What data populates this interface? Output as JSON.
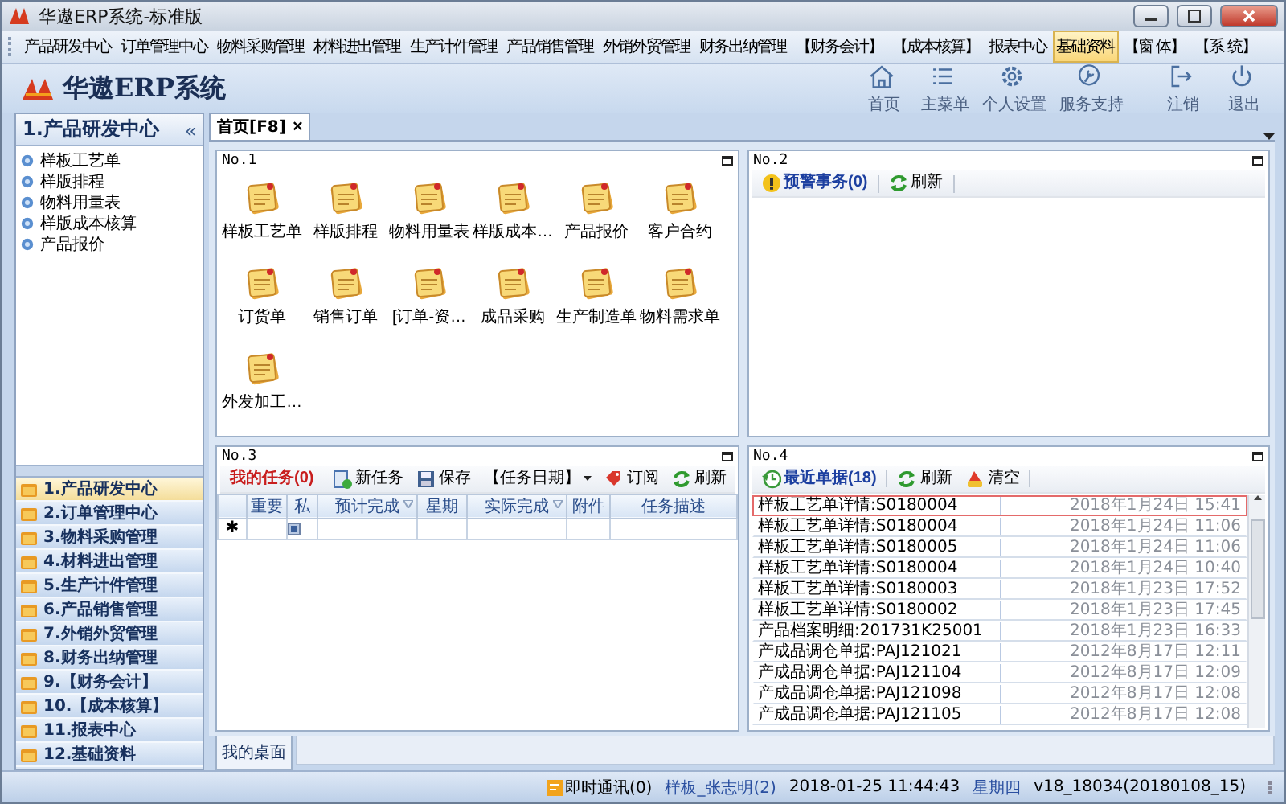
{
  "window": {
    "title": "华遨ERP系统-标准版"
  },
  "menu": [
    {
      "label": "产品研发中心",
      "selected": false
    },
    {
      "label": "订单管理中心",
      "selected": false
    },
    {
      "label": "物料采购管理",
      "selected": false
    },
    {
      "label": "材料进出管理",
      "selected": false
    },
    {
      "label": "生产计件管理",
      "selected": false
    },
    {
      "label": "产品销售管理",
      "selected": false
    },
    {
      "label": "外销外贸管理",
      "selected": false
    },
    {
      "label": "财务出纳管理",
      "selected": false
    },
    {
      "label": "【财务会计】",
      "selected": false
    },
    {
      "label": "【成本核算】",
      "selected": false
    },
    {
      "label": "报表中心",
      "selected": false
    },
    {
      "label": "基础资料",
      "selected": true
    },
    {
      "label": "【窗 体】",
      "selected": false
    },
    {
      "label": "【系 统】",
      "selected": false
    }
  ],
  "header": {
    "logo_text": "华遨ERP系统",
    "tools": [
      {
        "kind": "home",
        "label": "首页"
      },
      {
        "kind": "menu",
        "label": "主菜单"
      },
      {
        "kind": "settings",
        "label": "个人设置"
      },
      {
        "kind": "support",
        "label": "服务支持"
      },
      {
        "kind": "logout",
        "label": "注销"
      },
      {
        "kind": "exit",
        "label": "退出"
      }
    ]
  },
  "sidebar": {
    "title": "1.产品研发中心",
    "collapse": "«",
    "items": [
      "样板工艺单",
      "样版排程",
      "物料用量表",
      "样版成本核算",
      "产品报价"
    ],
    "groups": [
      {
        "label": "1.产品研发中心",
        "selected": true
      },
      {
        "label": "2.订单管理中心",
        "selected": false
      },
      {
        "label": "3.物料采购管理",
        "selected": false
      },
      {
        "label": "4.材料进出管理",
        "selected": false
      },
      {
        "label": "5.生产计件管理",
        "selected": false
      },
      {
        "label": "6.产品销售管理",
        "selected": false
      },
      {
        "label": "7.外销外贸管理",
        "selected": false
      },
      {
        "label": "8.财务出纳管理",
        "selected": false
      },
      {
        "label": "9.【财务会计】",
        "selected": false
      },
      {
        "label": "10.【成本核算】",
        "selected": false
      },
      {
        "label": "11.报表中心",
        "selected": false
      },
      {
        "label": "12.基础资料",
        "selected": false
      }
    ]
  },
  "tabs": [
    {
      "label": "首页[F8]",
      "close": "×",
      "selected": true
    }
  ],
  "panel_1": {
    "title": "No.1",
    "shortcuts": [
      "样板工艺单",
      "样版排程",
      "物料用量表",
      "样版成本…",
      "产品报价",
      "客户合约",
      "订货单",
      "销售订单",
      "[订单-资…",
      "成品采购",
      "生产制造单",
      "物料需求单",
      "外发加工…"
    ]
  },
  "panel_2": {
    "title": "No.2",
    "toolbar": [
      {
        "kind": "warning",
        "label": "预警事务(0)"
      },
      {
        "kind": "refresh",
        "label": "刷新"
      }
    ]
  },
  "panel_3": {
    "title": "No.3",
    "toolbar": [
      {
        "kind": "tasks",
        "label": "我的任务(0)"
      },
      {
        "kind": "new",
        "label": "新任务"
      },
      {
        "kind": "save",
        "label": "保存"
      },
      {
        "kind": "dropdown",
        "label": "【任务日期】"
      },
      {
        "kind": "subscribe",
        "label": "订阅"
      },
      {
        "kind": "refresh",
        "label": "刷新"
      }
    ],
    "columns": [
      {
        "label": "重要",
        "filter": false
      },
      {
        "label": "私",
        "filter": false
      },
      {
        "label": "预计完成",
        "filter": true
      },
      {
        "label": "星期",
        "filter": false
      },
      {
        "label": "实际完成",
        "filter": true
      },
      {
        "label": "附件",
        "filter": false
      },
      {
        "label": "任务描述",
        "filter": false
      }
    ],
    "new_row_marker": "✱"
  },
  "panel_4": {
    "title": "No.4",
    "toolbar": [
      {
        "kind": "recent",
        "label": "最近单据(18)"
      },
      {
        "kind": "refresh",
        "label": "刷新"
      },
      {
        "kind": "clear",
        "label": "清空"
      }
    ],
    "rows": [
      {
        "name": "样板工艺单详情:S0180004",
        "date": "2018年1月24日",
        "time": "15:41",
        "selected": true
      },
      {
        "name": "样板工艺单详情:S0180004",
        "date": "2018年1月24日",
        "time": "11:06",
        "selected": false
      },
      {
        "name": "样板工艺单详情:S0180005",
        "date": "2018年1月24日",
        "time": "11:06",
        "selected": false
      },
      {
        "name": "样板工艺单详情:S0180004",
        "date": "2018年1月24日",
        "time": "10:40",
        "selected": false
      },
      {
        "name": "样板工艺单详情:S0180003",
        "date": "2018年1月23日",
        "time": "17:52",
        "selected": false
      },
      {
        "name": "样板工艺单详情:S0180002",
        "date": "2018年1月23日",
        "time": "17:45",
        "selected": false
      },
      {
        "name": "产品档案明细:201731K25001",
        "date": "2018年1月23日",
        "time": "16:33",
        "selected": false
      },
      {
        "name": "产成品调仓单据:PAJ121021",
        "date": "2012年8月17日",
        "time": "12:11",
        "selected": false
      },
      {
        "name": "产成品调仓单据:PAJ121104",
        "date": "2012年8月17日",
        "time": "12:09",
        "selected": false
      },
      {
        "name": "产成品调仓单据:PAJ121098",
        "date": "2012年8月17日",
        "time": "12:08",
        "selected": false
      },
      {
        "name": "产成品调仓单据:PAJ121105",
        "date": "2012年8月17日",
        "time": "12:08",
        "selected": false
      }
    ]
  },
  "bottom_tabs": [
    {
      "label": "我的桌面",
      "selected": true
    }
  ],
  "status_bar": {
    "messenger": "即时通讯(0)",
    "user": "样板_张志明(2)",
    "datetime": "2018-01-25 11:44:43",
    "weekday": "星期四",
    "version": "v18_18034(20180108_15)"
  }
}
